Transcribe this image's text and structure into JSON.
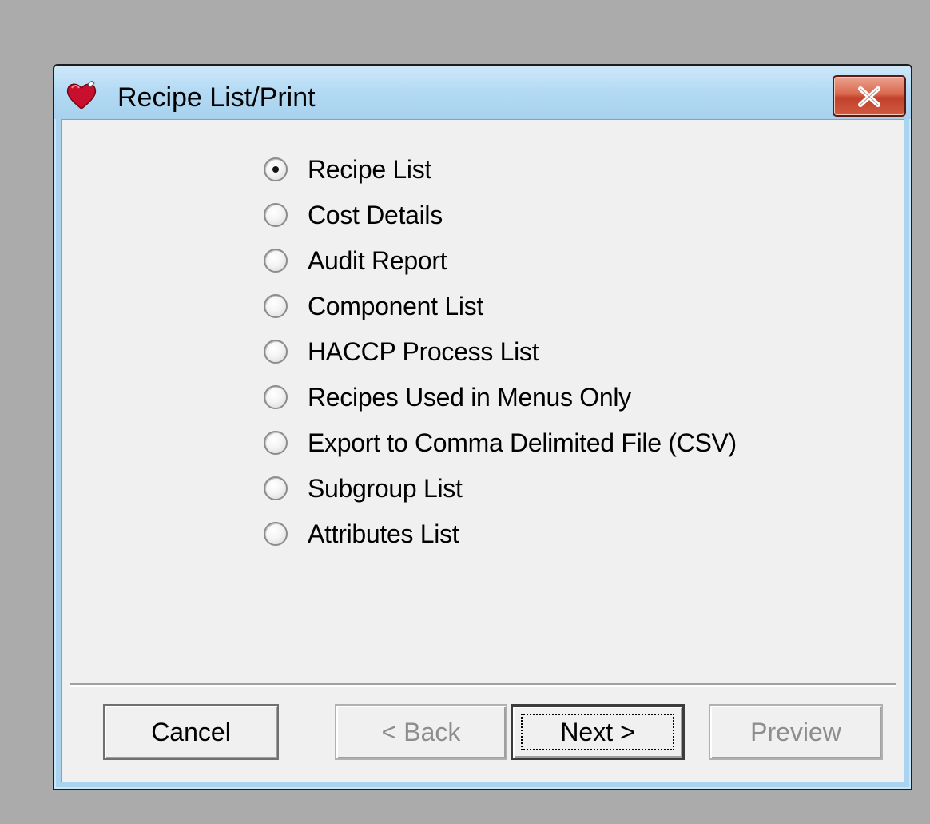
{
  "window": {
    "title": "Recipe List/Print",
    "app_icon": "red-heart-icon",
    "close_icon": "close-x-icon"
  },
  "options": [
    {
      "label": "Recipe List",
      "selected": true
    },
    {
      "label": "Cost Details",
      "selected": false
    },
    {
      "label": "Audit Report",
      "selected": false
    },
    {
      "label": "Component List",
      "selected": false
    },
    {
      "label": "HACCP Process List",
      "selected": false
    },
    {
      "label": "Recipes Used in Menus Only",
      "selected": false
    },
    {
      "label": "Export to Comma Delimited File (CSV)",
      "selected": false
    },
    {
      "label": "Subgroup List",
      "selected": false
    },
    {
      "label": "Attributes List",
      "selected": false
    }
  ],
  "buttons": {
    "cancel": {
      "label": "Cancel",
      "enabled": true
    },
    "back": {
      "label": "< Back",
      "enabled": false
    },
    "next": {
      "label": "Next >",
      "enabled": true
    },
    "preview": {
      "label": "Preview",
      "enabled": false
    }
  },
  "colors": {
    "desktop": "#ababab",
    "client": "#f0f0f0",
    "titlebar": "#b4dbf4",
    "close_button": "#d9684f",
    "disabled_text": "#8d8d8d"
  }
}
